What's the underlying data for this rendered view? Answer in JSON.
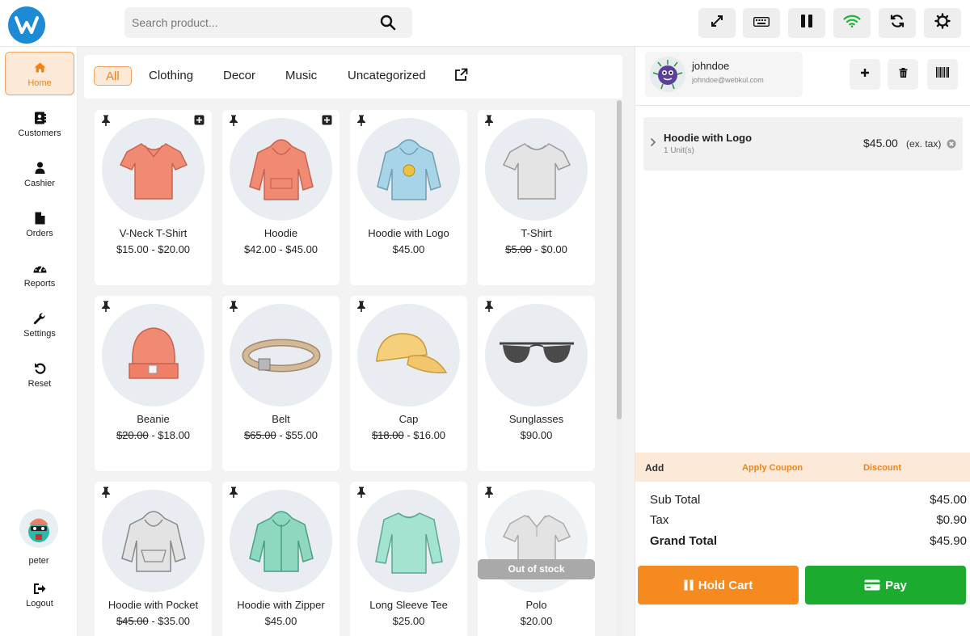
{
  "search": {
    "placeholder": "Search product..."
  },
  "toolbar": [
    {
      "name": "fullscreen-icon"
    },
    {
      "name": "keyboard-icon"
    },
    {
      "name": "pause-icon"
    },
    {
      "name": "wifi-icon",
      "color": "#22b33a"
    },
    {
      "name": "sync-icon"
    },
    {
      "name": "gear-icon"
    }
  ],
  "sidebar": {
    "items": [
      {
        "label": "Home",
        "icon": "home-icon",
        "active": true
      },
      {
        "label": "Customers",
        "icon": "address-book-icon"
      },
      {
        "label": "Cashier",
        "icon": "user-icon"
      },
      {
        "label": "Orders",
        "icon": "file-icon"
      },
      {
        "label": "Reports",
        "icon": "dashboard-icon"
      },
      {
        "label": "Settings",
        "icon": "wrench-icon"
      },
      {
        "label": "Reset",
        "icon": "undo-icon"
      }
    ],
    "user": {
      "name": "peter"
    },
    "logout": "Logout"
  },
  "categories": {
    "items": [
      "All",
      "Clothing",
      "Decor",
      "Music",
      "Uncategorized"
    ],
    "active": "All",
    "external_icon": "external-link-icon"
  },
  "products": [
    {
      "name": "V-Neck T-Shirt",
      "price": "$15.00 - $20.00",
      "icon": "tshirt"
    },
    {
      "name": "Hoodie",
      "price": "$42.00 - $45.00",
      "icon": "hoodie"
    },
    {
      "name": "Hoodie with Logo",
      "price": "$45.00",
      "icon": "hoodie-logo"
    },
    {
      "name": "T-Shirt",
      "old_price": "$5.00",
      "price": " - $0.00",
      "icon": "tshirt-grey"
    },
    {
      "name": "Beanie",
      "old_price": "$20.00",
      "price": " - $18.00",
      "icon": "beanie"
    },
    {
      "name": "Belt",
      "old_price": "$65.00",
      "price": " - $55.00",
      "icon": "belt"
    },
    {
      "name": "Cap",
      "old_price": "$18.00",
      "price": " - $16.00",
      "icon": "cap"
    },
    {
      "name": "Sunglasses",
      "price": "$90.00",
      "icon": "sunglasses"
    },
    {
      "name": "Hoodie with Pocket",
      "old_price": "$45.00",
      "price": " - $35.00",
      "icon": "hoodie-pocket"
    },
    {
      "name": "Hoodie with Zipper",
      "price": "$45.00",
      "icon": "hoodie-zipper"
    },
    {
      "name": "Long Sleeve Tee",
      "price": "$25.00",
      "icon": "longsleeve"
    },
    {
      "name": "Polo",
      "price": "$20.00",
      "icon": "polo",
      "badge": "Out of stock"
    }
  ],
  "customer": {
    "name": "johndoe",
    "email": "johndoe@webkul.com"
  },
  "cart": {
    "items": [
      {
        "name": "Hoodie with Logo",
        "qty": "1 Unit(s)",
        "price": "$45.00",
        "tax_note": "(ex. tax)"
      }
    ]
  },
  "cart_actions": {
    "add": "Add",
    "coupon": "Apply Coupon",
    "discount": "Discount"
  },
  "totals": {
    "subtotal_label": "Sub Total",
    "subtotal": "$45.00",
    "tax_label": "Tax",
    "tax": "$0.90",
    "grand_label": "Grand Total",
    "grand": "$45.90"
  },
  "buttons": {
    "hold": "Hold Cart",
    "pay": "Pay"
  },
  "colors": {
    "accent": "#f0841a",
    "accent_bg": "#fde9d7",
    "hold": "#f78a1f",
    "pay": "#1aab2f",
    "brand": "#1d8ad6"
  }
}
